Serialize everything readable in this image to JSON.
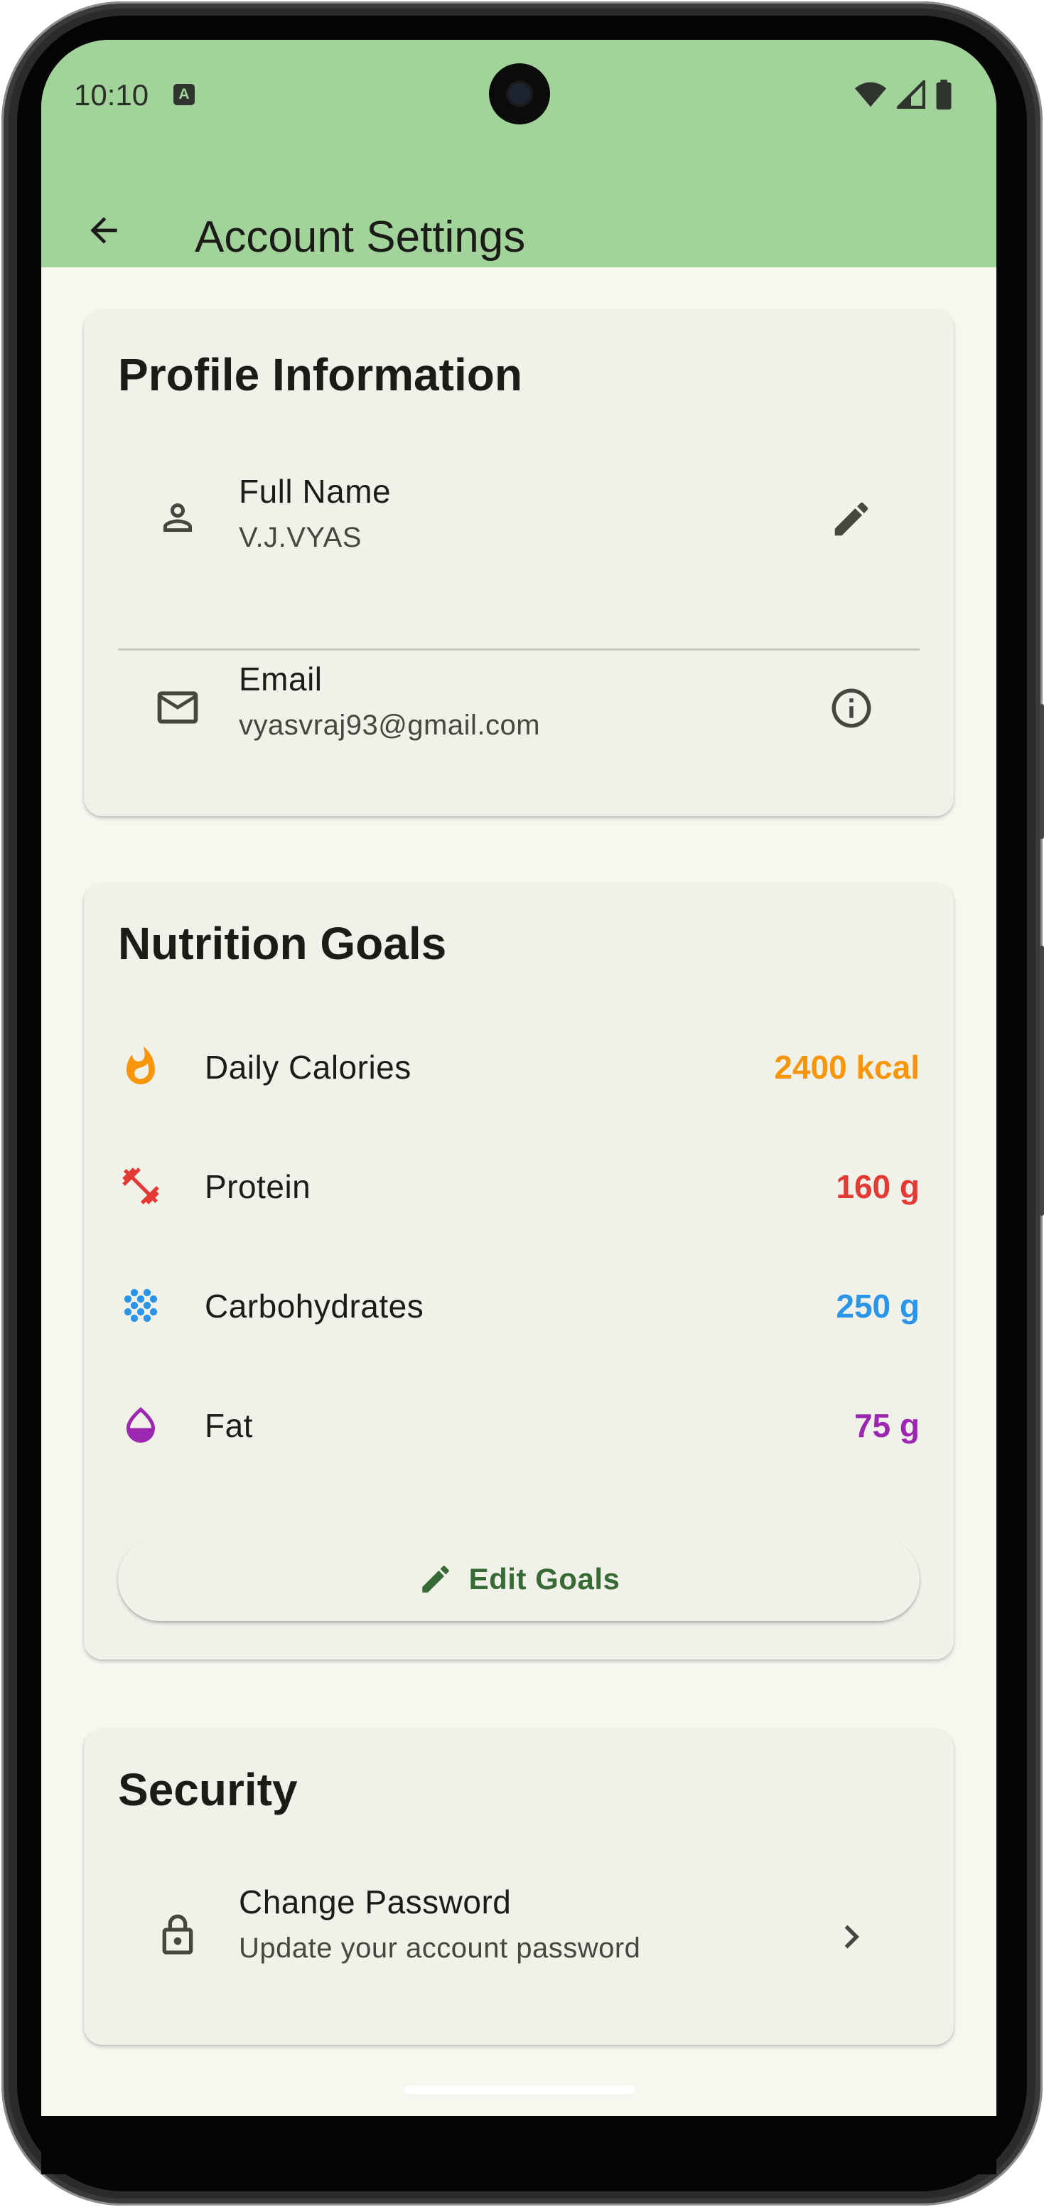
{
  "status_bar": {
    "time": "10:10",
    "notification_icon_letter": "A"
  },
  "app_bar": {
    "title": "Account Settings",
    "back_icon": "arrow-back-icon"
  },
  "profile": {
    "title": "Profile Information",
    "full_name": {
      "label": "Full Name",
      "value": "V.J.VYAS",
      "icon": "person-icon",
      "action_icon": "pencil-icon"
    },
    "email": {
      "label": "Email",
      "value": "vyasvraj93@gmail.com",
      "icon": "mail-icon",
      "action_icon": "info-icon"
    }
  },
  "nutrition": {
    "title": "Nutrition Goals",
    "goals": [
      {
        "label": "Daily Calories",
        "value": "2400 kcal",
        "color": "#f7960d",
        "icon": "flame-icon"
      },
      {
        "label": "Protein",
        "value": "160 g",
        "color": "#e53a34",
        "icon": "dumbbell-icon"
      },
      {
        "label": "Carbohydrates",
        "value": "250 g",
        "color": "#2b95ea",
        "icon": "grain-icon"
      },
      {
        "label": "Fat",
        "value": "75 g",
        "color": "#9c27b0",
        "icon": "water-drop-icon"
      }
    ],
    "edit_button": "Edit Goals"
  },
  "security": {
    "title": "Security",
    "change_password": {
      "label": "Change Password",
      "sub": "Update your account password",
      "icon": "lock-icon",
      "action_icon": "chevron-right-icon"
    }
  },
  "colors": {
    "app_bar": "#a2d39b",
    "background": "#f6f8f0",
    "card": "#f0f2ea",
    "accent_green": "#386a35"
  }
}
